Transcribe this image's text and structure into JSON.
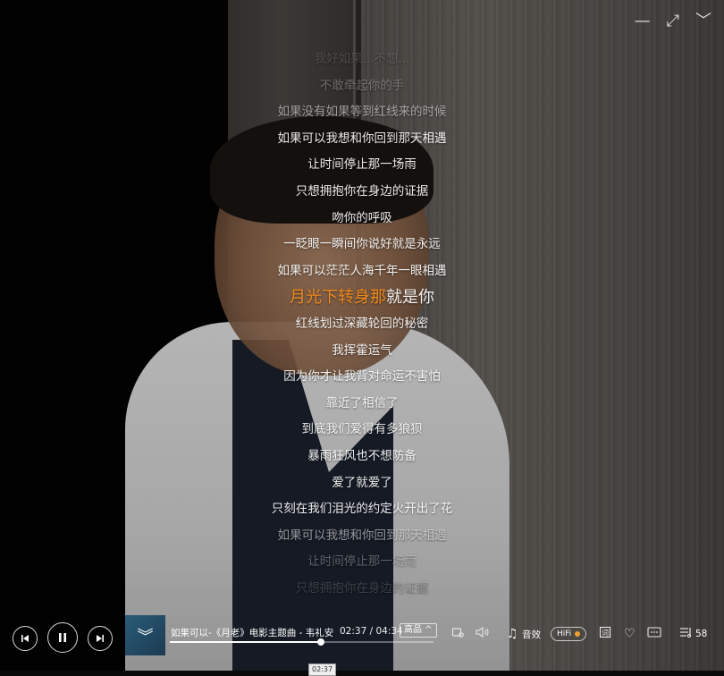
{
  "window": {
    "minimize_icon": "minimize-icon",
    "fullscreen_icon": "fullscreen-icon",
    "collapse_icon": "chevron-down-icon"
  },
  "lyrics": {
    "lines": [
      "我好如果...不想...",
      "不敢牵起你的手",
      "如果没有如果等到红线来的时候",
      "如果可以我想和你回到那天相遇",
      "让时间停止那一场雨",
      "只想拥抱你在身边的证据",
      "吻你的呼吸",
      "一眨眼一瞬间你说好就是永远",
      "如果可以茫茫人海千年一眼相遇",
      "月光下转身那就是你",
      "红线划过深藏轮回的秘密",
      "我挥霍运气",
      "因为你才让我背对命运不害怕",
      "靠近了相信了",
      "到底我们爱得有多狼狈",
      "暴雨狂风也不想防备",
      "爱了就爱了",
      "只刻在我们泪光的约定火开出了花",
      "如果可以我想和你回到那天相遇",
      "让时间停止那一场雨",
      "只想拥抱你在身边的证据"
    ],
    "current_index": 9,
    "current_sung": "月光下转身那",
    "current_unsung": "就是你"
  },
  "player": {
    "song_title": "如果可以-《月老》电影主题曲 - 韦礼安",
    "time_current": "02:37",
    "time_total": "04:34",
    "time_display": "02:37 / 04:34",
    "progress_fraction": 0.573,
    "quality": "高品 ^",
    "hover_time": "02:37",
    "sound_effect_label": "音效",
    "hifi_label": "HiFi",
    "playlist_count": "58",
    "cover_icon": "chevron-double-down-icon"
  },
  "colors": {
    "accent_orange": "#f08a1c",
    "lyric_text": "#ffffff"
  }
}
